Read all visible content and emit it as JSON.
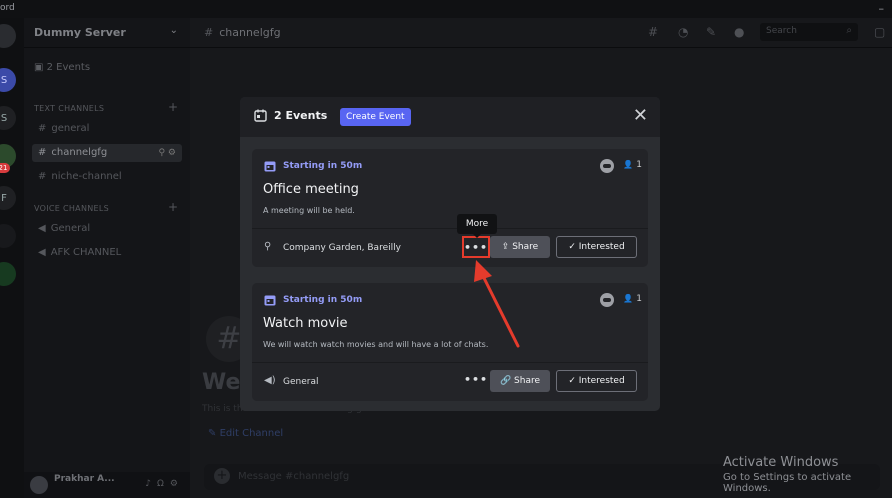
{
  "titlebar": {
    "app_name": "ord",
    "minimize": "–"
  },
  "server_rail": {
    "items": [
      {
        "label": "",
        "icon": "discord-icon"
      },
      {
        "label": "S"
      },
      {
        "label": "S"
      },
      {
        "label": "",
        "badge": "21"
      },
      {
        "label": "F"
      }
    ]
  },
  "sidebar": {
    "server_name": "Dummy Server",
    "events_label": "2 Events",
    "text_category": "TEXT CHANNELS",
    "voice_category": "VOICE CHANNELS",
    "text_channels": [
      "general",
      "channelgfg",
      "niche-channel"
    ],
    "voice_channels": [
      "General",
      "AFK CHANNEL"
    ],
    "user_name": "Prakhar A..."
  },
  "main": {
    "channel_name": "channelgfg",
    "search_placeholder": "Search",
    "welcome_title": "Wel",
    "welcome_sub": "This is the start of the #channelgfg channel.",
    "edit_channel": "Edit Channel",
    "composer_placeholder": "Message #channelgfg"
  },
  "modal": {
    "title": "2 Events",
    "create_label": "Create Event",
    "events": [
      {
        "when": "Starting in 50m",
        "interested_count": "1",
        "title": "Office meeting",
        "description": "A meeting will be held.",
        "location": "Company Garden, Bareilly",
        "location_icon": "map-pin-icon",
        "more_label": "•••",
        "share_label": "Share",
        "interested_label": "Interested"
      },
      {
        "when": "Starting in 50m",
        "interested_count": "1",
        "title": "Watch movie",
        "description": "We will watch watch movies and will have a lot of chats.",
        "location": "General",
        "location_icon": "speaker-icon",
        "more_label": "•••",
        "share_label": "Share",
        "interested_label": "Interested"
      }
    ]
  },
  "tooltip": {
    "text": "More"
  },
  "watermark": {
    "title": "Activate Windows",
    "sub": "Go to Settings to activate Windows."
  },
  "colors": {
    "accent": "#5865f2",
    "highlight": "#e43b2c",
    "event_time": "#949cf7"
  }
}
